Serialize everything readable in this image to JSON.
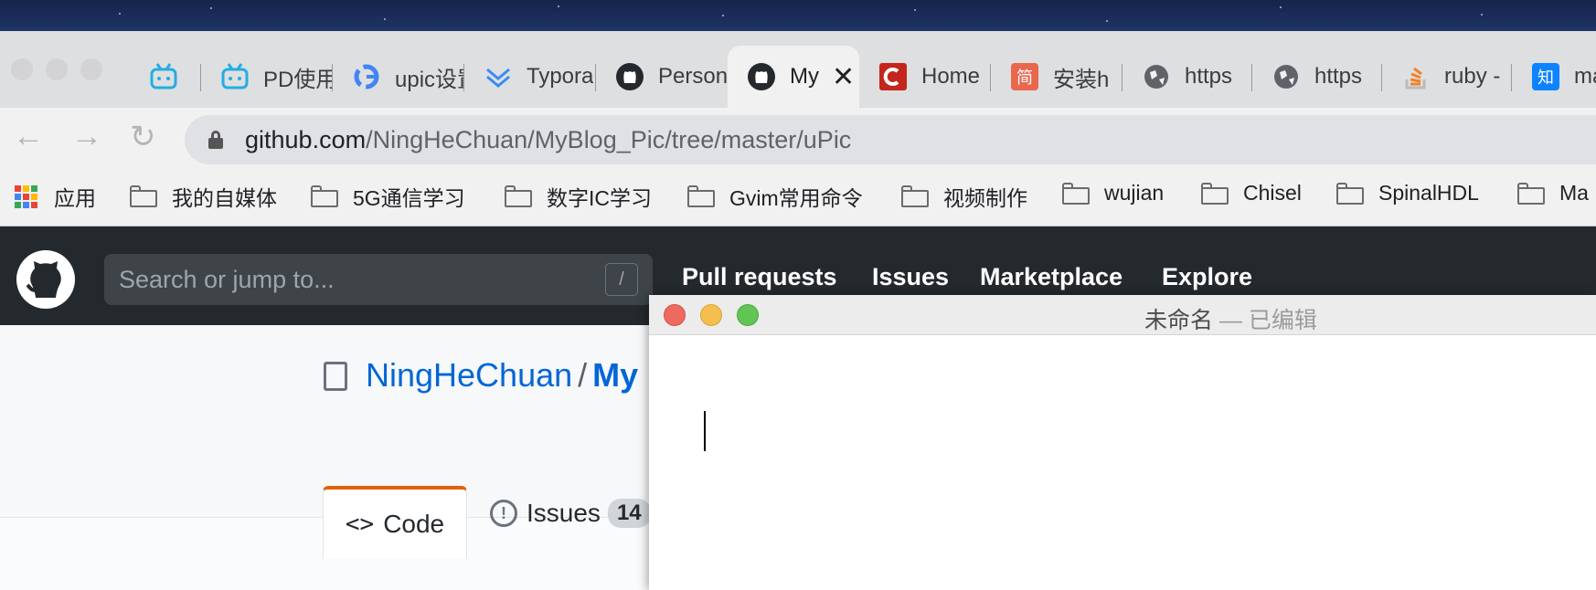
{
  "browser": {
    "tabs": [
      {
        "title": "",
        "icon": "bilibili-icon"
      },
      {
        "title": "PD使用",
        "icon": "bilibili-icon"
      },
      {
        "title": "upic设置",
        "icon": "google-icon"
      },
      {
        "title": "Typora",
        "icon": "typora-icon"
      },
      {
        "title": "Personal",
        "icon": "github-icon"
      },
      {
        "title": "My",
        "icon": "github-icon",
        "active": true
      },
      {
        "title": "Home",
        "icon": "coursera-icon"
      },
      {
        "title": "安装h",
        "icon": "jianshu-icon"
      },
      {
        "title": "https",
        "icon": "globe-icon"
      },
      {
        "title": "https",
        "icon": "globe-icon"
      },
      {
        "title": "ruby -",
        "icon": "stackoverflow-icon"
      },
      {
        "title": "ma",
        "icon": "zhihu-icon"
      }
    ],
    "active_tab_close": "✕",
    "nav": {
      "back": "←",
      "forward": "→",
      "reload": "↻"
    },
    "url_host": "github.com",
    "url_path": "/NingHeChuan/MyBlog_Pic/tree/master/uPic",
    "bookmarks": [
      {
        "label": "应用",
        "type": "apps"
      },
      {
        "label": "我的自媒体",
        "type": "folder"
      },
      {
        "label": "5G通信学习",
        "type": "folder"
      },
      {
        "label": "数字IC学习",
        "type": "folder"
      },
      {
        "label": "Gvim常用命令",
        "type": "folder"
      },
      {
        "label": "视频制作",
        "type": "folder"
      },
      {
        "label": "wujian",
        "type": "folder"
      },
      {
        "label": "Chisel",
        "type": "folder"
      },
      {
        "label": "SpinalHDL",
        "type": "folder"
      },
      {
        "label": "Ma",
        "type": "folder"
      }
    ]
  },
  "github": {
    "search_placeholder": "Search or jump to...",
    "search_key": "/",
    "nav": [
      "Pull requests",
      "Issues",
      "Marketplace",
      "Explore"
    ],
    "owner": "NingHeChuan",
    "slash": "/",
    "repo": "My",
    "tabs": {
      "code": "Code",
      "code_icon": "<>",
      "issues": "Issues",
      "issues_count": "14"
    }
  },
  "textedit": {
    "title": "未命名",
    "edited": " — 已编辑"
  },
  "colors": {
    "gh_header": "#24292e",
    "gh_link": "#0366d6",
    "tab_accent": "#e36209",
    "close": "#ed6a5e",
    "minimize": "#f5bf4f",
    "zoom": "#61c554"
  }
}
